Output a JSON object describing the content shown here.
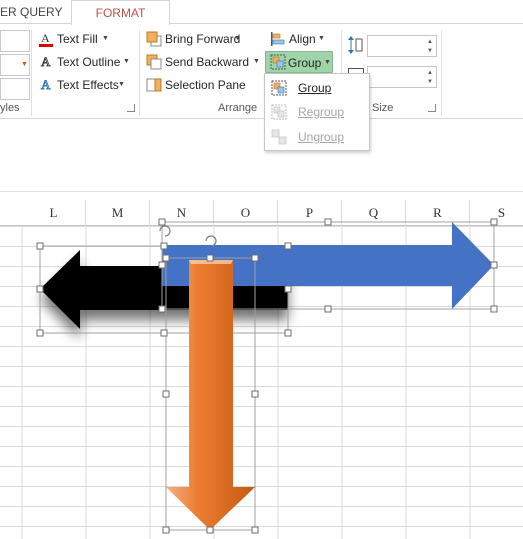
{
  "tabs": [
    {
      "label": "ER QUERY"
    },
    {
      "label": "FORMAT"
    }
  ],
  "ribbon": {
    "wordart": {
      "text_fill": "Text Fill",
      "text_outline": "Text Outline",
      "text_effects": "Text Effects",
      "group_label": "yles"
    },
    "arrange": {
      "bring_forward": "Bring Forward",
      "send_backward": "Send Backward",
      "selection_pane": "Selection Pane",
      "align": "Align",
      "group": "Group",
      "group_label": "Arrange"
    },
    "size": {
      "group_label": "Size",
      "height_value": "",
      "width_value": ""
    }
  },
  "group_menu": [
    {
      "label": "Group",
      "enabled": true,
      "icon": "group-icon"
    },
    {
      "label": "Regroup",
      "enabled": false,
      "icon": "regroup-icon"
    },
    {
      "label": "Ungroup",
      "enabled": false,
      "icon": "ungroup-icon"
    }
  ],
  "columns": [
    "L",
    "M",
    "N",
    "O",
    "P",
    "Q",
    "R",
    "S"
  ],
  "colors": {
    "format_tab": "#c0504d",
    "group_button_highlight": "#9fd3a8",
    "arrow_blue": "#4472c4",
    "arrow_black": "#000000",
    "arrow_orange": "#ed7d31"
  }
}
